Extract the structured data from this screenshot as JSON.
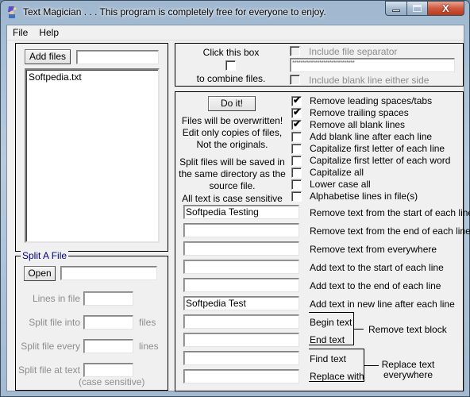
{
  "window": {
    "title": "Text Magician . . . This program is completely free for everyone to enjoy.",
    "icon": "wizard-icon",
    "controls": {
      "minimize": "minimize-icon",
      "maximize": "maximize-icon",
      "close": "close-icon",
      "close_glyph": "X"
    }
  },
  "menu": [
    {
      "label": "File"
    },
    {
      "label": "Help"
    }
  ],
  "files_panel": {
    "add_files_label": "Add files",
    "add_files_input": "",
    "file_list": [
      "Softpedia.txt"
    ]
  },
  "split_panel": {
    "legend": "Split A File",
    "open_label": "Open",
    "open_input": "",
    "lines_in_file_label": "Lines in file",
    "lines_in_file_value": "",
    "split_into_label": "Split file into",
    "split_into_value": "",
    "split_into_unit": "files",
    "split_every_label": "Split file every",
    "split_every_value": "",
    "split_every_unit": "lines",
    "split_at_text_label": "Split file at text",
    "split_at_text_value": "",
    "case_sensitive_note": "(case sensitive)"
  },
  "combine_panel": {
    "click_box_text": "Click this box",
    "combine_text": "to combine files.",
    "combine_checked": false,
    "include_separator_label": "Include file separator",
    "include_separator_checked": false,
    "separator_value": "******************************",
    "include_blank_label": "Include blank line either side",
    "include_blank_checked": false
  },
  "main_panel": {
    "do_it_label": "Do it!",
    "warning_lines": [
      "Files will be overwritten!",
      "Edit only copies of files,",
      "Not the originals."
    ],
    "split_note_lines": [
      "Split files will be saved in",
      "the same directory as the",
      "source file."
    ],
    "case_note": "All text is case sensitive",
    "options": [
      {
        "label": "Remove leading spaces/tabs",
        "checked": true
      },
      {
        "label": "Remove trailing spaces",
        "checked": true
      },
      {
        "label": "Remove all blank lines",
        "checked": true
      },
      {
        "label": "Add blank line after each line",
        "checked": false
      },
      {
        "label": "Capitalize first letter of each line",
        "checked": false
      },
      {
        "label": "Capitalize first letter of each word",
        "checked": false
      },
      {
        "label": "Capitalize all",
        "checked": false
      },
      {
        "label": "Lower case all",
        "checked": false
      },
      {
        "label": "Alphabetise lines in file(s)",
        "checked": false
      }
    ],
    "text_ops": [
      {
        "value": "Softpedia Testing",
        "label": "Remove text from the start of each line"
      },
      {
        "value": "",
        "label": "Remove text from the end of each line"
      },
      {
        "value": "",
        "label": "Remove text from everywhere"
      },
      {
        "value": "",
        "label": "Add text to the start of each line"
      },
      {
        "value": "",
        "label": "Add text to the end of each line"
      },
      {
        "value": "Softpedia Test",
        "label": "Add text in new line after each line"
      }
    ],
    "block": {
      "begin_value": "",
      "begin_label": "Begin text",
      "end_value": "",
      "end_label": "End text",
      "group_label": "Remove text block"
    },
    "replace": {
      "find_value": "",
      "find_label": "Find text",
      "replace_value": "",
      "replace_label": "Replace with",
      "group_label_1": "Replace text",
      "group_label_2": "everywhere"
    }
  }
}
